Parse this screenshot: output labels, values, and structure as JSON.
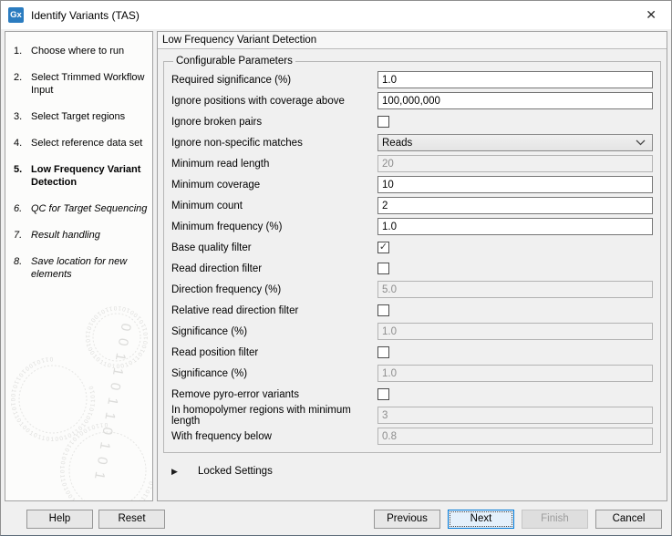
{
  "window": {
    "title": "Identify Variants (TAS)",
    "icon_text": "Gx",
    "close_glyph": "✕"
  },
  "sidebar": {
    "steps": [
      {
        "num": "1.",
        "label": "Choose where to run",
        "current": false,
        "upcoming": false
      },
      {
        "num": "2.",
        "label": "Select Trimmed Workflow Input",
        "current": false,
        "upcoming": false
      },
      {
        "num": "3.",
        "label": "Select Target regions",
        "current": false,
        "upcoming": false
      },
      {
        "num": "4.",
        "label": "Select reference data set",
        "current": false,
        "upcoming": false
      },
      {
        "num": "5.",
        "label": "Low Frequency Variant Detection",
        "current": true,
        "upcoming": false
      },
      {
        "num": "6.",
        "label": "QC for Target Sequencing",
        "current": false,
        "upcoming": true
      },
      {
        "num": "7.",
        "label": "Result handling",
        "current": false,
        "upcoming": true
      },
      {
        "num": "8.",
        "label": "Save location for new elements",
        "current": false,
        "upcoming": true
      }
    ],
    "watermark_digits": "0110100101101001011010010110100101101001011010",
    "watermark_digits_large": "0 0 1 1 0 1 1 0 1 0 1"
  },
  "panel": {
    "header": "Low Frequency Variant Detection",
    "group_title": "Configurable Parameters",
    "rows": [
      {
        "label": "Required significance (%)",
        "type": "text",
        "value": "1.0",
        "enabled": true
      },
      {
        "label": "Ignore positions with coverage above",
        "type": "text",
        "value": "100,000,000",
        "enabled": true
      },
      {
        "label": "Ignore broken pairs",
        "type": "checkbox",
        "checked": false,
        "enabled": true
      },
      {
        "label": "Ignore non-specific matches",
        "type": "select",
        "value": "Reads",
        "enabled": true
      },
      {
        "label": "Minimum read length",
        "type": "text",
        "value": "20",
        "enabled": false
      },
      {
        "label": "Minimum coverage",
        "type": "text",
        "value": "10",
        "enabled": true
      },
      {
        "label": "Minimum count",
        "type": "text",
        "value": "2",
        "enabled": true
      },
      {
        "label": "Minimum frequency (%)",
        "type": "text",
        "value": "1.0",
        "enabled": true
      },
      {
        "label": "Base quality filter",
        "type": "checkbox",
        "checked": true,
        "enabled": true
      },
      {
        "label": "Read direction filter",
        "type": "checkbox",
        "checked": false,
        "enabled": true
      },
      {
        "label": "Direction frequency (%)",
        "type": "text",
        "value": "5.0",
        "enabled": false
      },
      {
        "label": "Relative read direction filter",
        "type": "checkbox",
        "checked": false,
        "enabled": true
      },
      {
        "label": "Significance (%)",
        "type": "text",
        "value": "1.0",
        "enabled": false
      },
      {
        "label": "Read position filter",
        "type": "checkbox",
        "checked": false,
        "enabled": true
      },
      {
        "label": "Significance (%)",
        "type": "text",
        "value": "1.0",
        "enabled": false
      },
      {
        "label": "Remove pyro-error variants",
        "type": "checkbox",
        "checked": false,
        "enabled": true
      },
      {
        "label": "In homopolymer regions with minimum length",
        "type": "text",
        "value": "3",
        "enabled": false
      },
      {
        "label": "With frequency below",
        "type": "text",
        "value": "0.8",
        "enabled": false
      }
    ],
    "locked_settings": {
      "icon": "▶",
      "label": "Locked Settings"
    }
  },
  "footer": {
    "help_label": "Help",
    "reset_label": "Reset",
    "previous_label": "Previous",
    "next_label": "Next",
    "finish_label": "Finish",
    "cancel_label": "Cancel"
  },
  "colors": {
    "accent_blue": "#0078d7",
    "app_icon_blue": "#2b7cc0",
    "dialog_gray": "#f0f0f0",
    "disabled_text": "#8d8d8d"
  }
}
